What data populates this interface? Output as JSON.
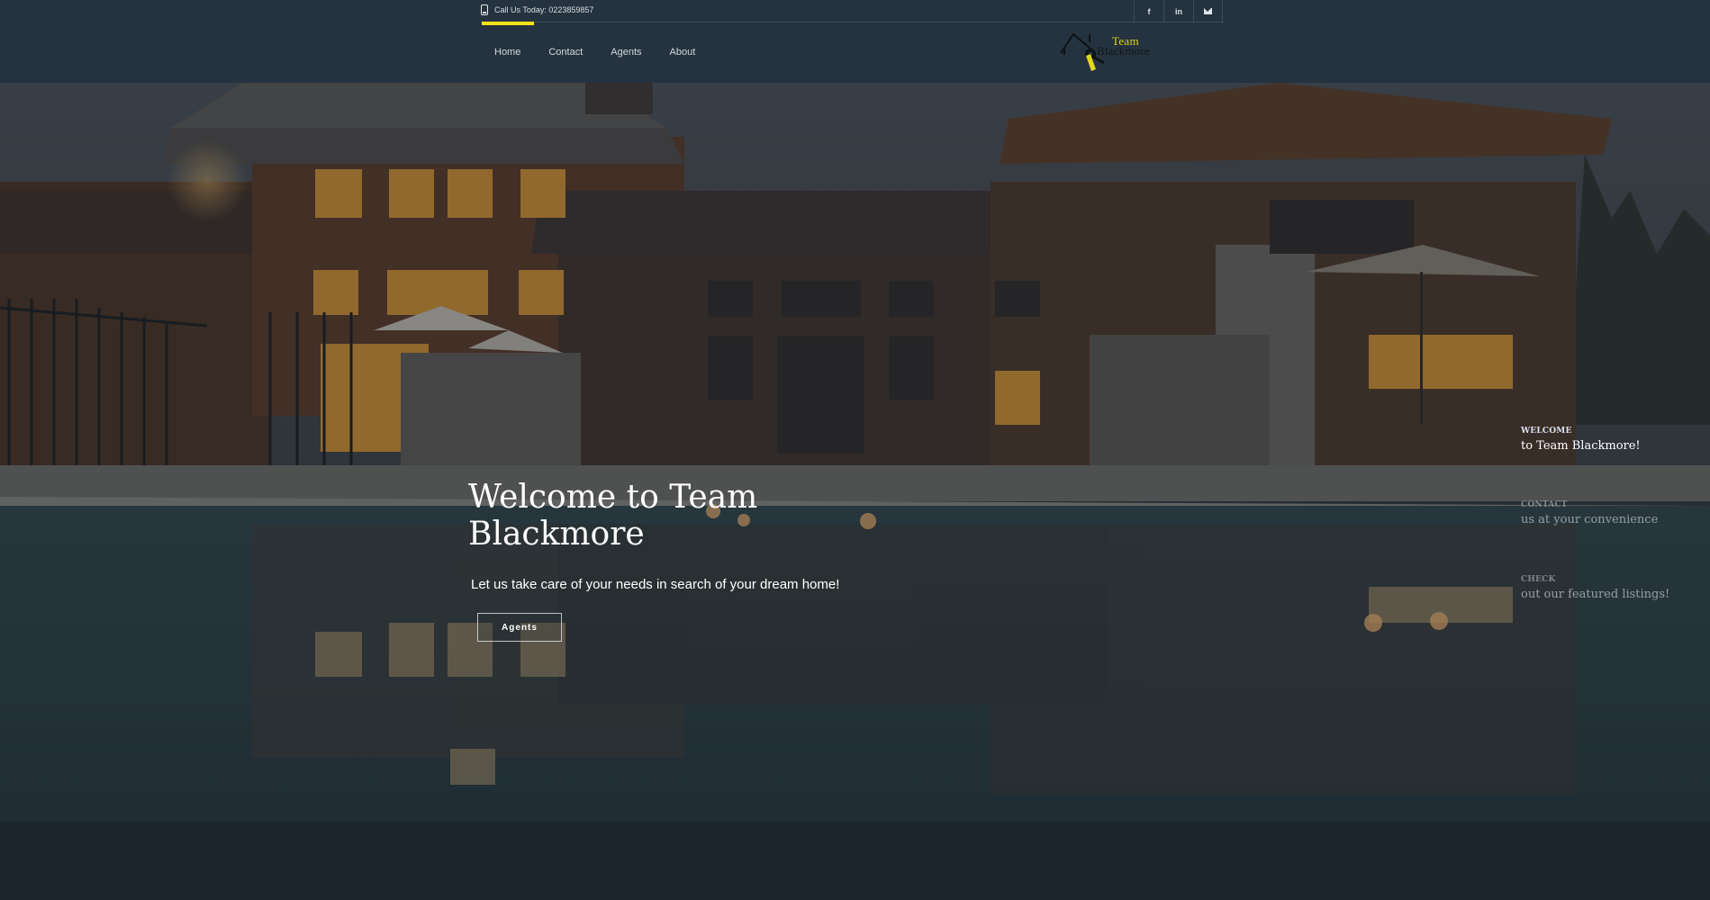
{
  "topbar": {
    "phone_text": "Call Us Today: 0223859857",
    "social": [
      {
        "icon": "facebook-icon",
        "glyph": "f"
      },
      {
        "icon": "linkedin-icon",
        "glyph": "in"
      },
      {
        "icon": "mail-icon",
        "glyph": ""
      }
    ],
    "accent_color": "#f3e21a"
  },
  "nav": {
    "items": [
      "Home",
      "Contact",
      "Agents",
      "About"
    ]
  },
  "logo": {
    "line1": "Team",
    "line2": "Blackmore"
  },
  "hero": {
    "title": "Welcome to Team Blackmore",
    "subtitle": "Let us take care of your needs in search of your dream home!",
    "button_label": "Agents"
  },
  "slides": [
    {
      "small": "WELCOME",
      "big": "to Team Blackmore!"
    },
    {
      "small": "CONTACT",
      "big": "us at your convenience"
    },
    {
      "small": "CHECK",
      "big": "out our featured listings!"
    }
  ]
}
